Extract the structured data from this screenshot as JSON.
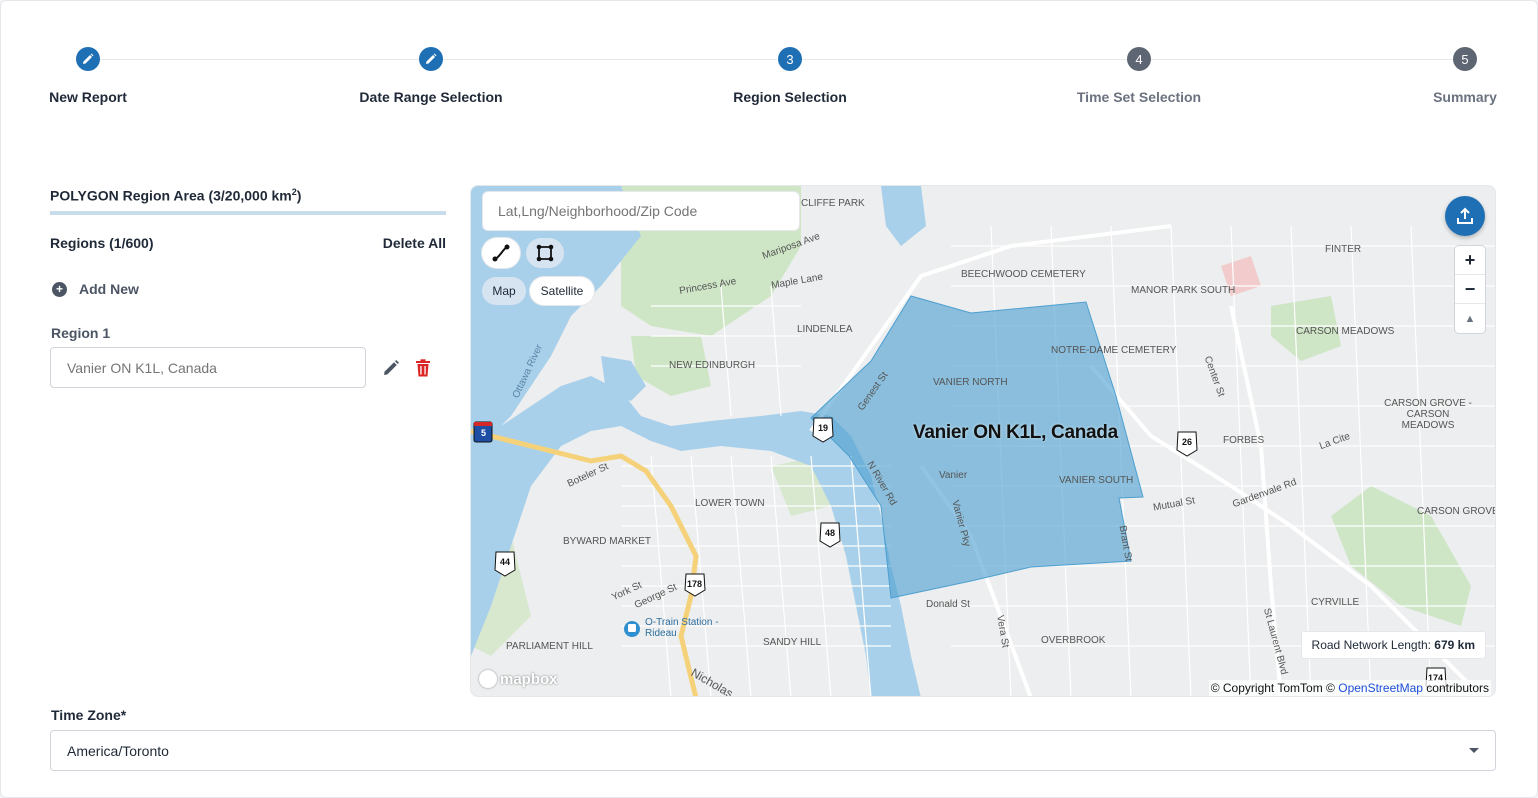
{
  "stepper": {
    "steps": [
      {
        "label": "New Report",
        "state": "done",
        "marker": "pencil-icon"
      },
      {
        "label": "Date Range Selection",
        "state": "done",
        "marker": "pencil-icon"
      },
      {
        "label": "Region Selection",
        "state": "active",
        "number": "3"
      },
      {
        "label": "Time Set Selection",
        "state": "todo",
        "number": "4"
      },
      {
        "label": "Summary",
        "state": "todo",
        "number": "5"
      }
    ]
  },
  "left": {
    "area_title": "POLYGON Region Area (3/20,000 km",
    "area_sup": "2",
    "area_title_end": ")",
    "regions_count": "Regions (1/600)",
    "delete_all": "Delete All",
    "add_new": "Add New",
    "region_label": "Region 1",
    "region_placeholder": "Vanier ON K1L, Canada"
  },
  "map": {
    "search_placeholder": "Lat,Lng/Neighborhood/Zip Code",
    "toggle_map": "Map",
    "toggle_satellite": "Satellite",
    "zoom_in": "+",
    "zoom_out": "−",
    "compass": "▲",
    "region_name": "Vanier ON K1L, Canada",
    "road_label": "Road Network Length:",
    "road_value": "679 km",
    "copyright_prefix": "© Copyright TomTom ©",
    "copyright_link": "OpenStreetMap",
    "copyright_suffix": "contributors",
    "logo": "mapbox",
    "labels": {
      "cliffe_park": "CLIFFE PARK",
      "mariposa": "Mariposa Ave",
      "maple_lane": "Maple Lane",
      "princess": "Princess Ave",
      "lindenlea": "LINDENLEA",
      "new_edinburgh": "NEW EDINBURGH",
      "beechwood": "BEECHWOOD CEMETERY",
      "manor_park": "MANOR PARK SOUTH",
      "finter": "FINTER",
      "carson_meadows": "CARSON MEADOWS",
      "notre_dame": "NOTRE-DAME CEMETERY",
      "vanier_north": "VANIER NORTH",
      "vanier": "Vanier",
      "vanier_south": "VANIER SOUTH",
      "forbes": "FORBES",
      "carson_grove_cm": "CARSON GROVE - CARSON MEADOWS",
      "la_cite": "La Cite",
      "gardenvale": "Gardenvale Rd",
      "mutual": "Mutual St",
      "carson_grove": "CARSON GROVE",
      "lower_town": "LOWER TOWN",
      "byward": "BYWARD MARKET",
      "boteler": "Boteler St",
      "donald": "Donald St",
      "cyrville": "CYRVILLE",
      "overbrook": "OVERBROOK",
      "sandy_hill": "SANDY HILL",
      "parliament": "PARLIAMENT HILL",
      "otrain": "O-Train Station - Rideau",
      "ottawa_river": "Ottawa River",
      "center_st": "Center St",
      "vanier_pky": "Vanier Pky",
      "n_river": "N River Rd",
      "york": "York St",
      "george": "George St",
      "stlaurent": "St Laurent Blvd",
      "vera": "Vera St",
      "brant": "Brant St",
      "genest": "Genest St",
      "nicholas": "Nicholas",
      "sh5": "5",
      "sh19": "19",
      "sh26": "26",
      "sh44": "44",
      "sh48": "48",
      "sh174": "174",
      "sh178": "178"
    }
  },
  "timezone": {
    "label": "Time Zone*",
    "value": "America/Toronto"
  }
}
